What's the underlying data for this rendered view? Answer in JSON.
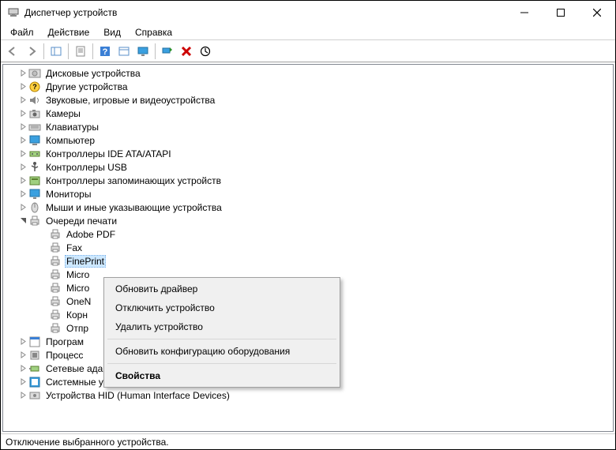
{
  "titlebar": {
    "title": "Диспетчер устройств"
  },
  "menubar": {
    "items": [
      "Файл",
      "Действие",
      "Вид",
      "Справка"
    ]
  },
  "toolbar": {
    "icons": [
      "back",
      "forward",
      "show-hide",
      "properties",
      "help",
      "options",
      "monitor",
      "scan",
      "delete",
      "update"
    ]
  },
  "tree": {
    "categories": [
      {
        "label": "Дисковые устройства",
        "icon": "disk"
      },
      {
        "label": "Другие устройства",
        "icon": "other"
      },
      {
        "label": "Звуковые, игровые и видеоустройства",
        "icon": "sound"
      },
      {
        "label": "Камеры",
        "icon": "camera"
      },
      {
        "label": "Клавиатуры",
        "icon": "keyboard"
      },
      {
        "label": "Компьютер",
        "icon": "computer"
      },
      {
        "label": "Контроллеры IDE ATA/ATAPI",
        "icon": "ide"
      },
      {
        "label": "Контроллеры USB",
        "icon": "usb"
      },
      {
        "label": "Контроллеры запоминающих устройств",
        "icon": "storage"
      },
      {
        "label": "Мониторы",
        "icon": "monitor"
      },
      {
        "label": "Мыши и иные указывающие устройства",
        "icon": "mouse"
      },
      {
        "label": "Очереди печати",
        "icon": "printer",
        "expanded": true,
        "children": [
          {
            "label": "Adobe PDF"
          },
          {
            "label": "Fax"
          },
          {
            "label": "FinePrint",
            "selected": true
          },
          {
            "label": "Micro"
          },
          {
            "label": "Micro"
          },
          {
            "label": "OneN"
          },
          {
            "label": "Корн"
          },
          {
            "label": "Отпр"
          }
        ]
      },
      {
        "label": "Програм",
        "icon": "program"
      },
      {
        "label": "Процесс",
        "icon": "cpu"
      },
      {
        "label": "Сетевые адаптеры",
        "icon": "network"
      },
      {
        "label": "Системные устройства",
        "icon": "system"
      },
      {
        "label": "Устройства HID (Human Interface Devices)",
        "icon": "hid"
      }
    ]
  },
  "context_menu": {
    "items": [
      {
        "label": "Обновить драйвер"
      },
      {
        "label": "Отключить устройство"
      },
      {
        "label": "Удалить устройство"
      },
      {
        "sep": true
      },
      {
        "label": "Обновить конфигурацию оборудования"
      },
      {
        "sep": true
      },
      {
        "label": "Свойства",
        "bold": true
      }
    ]
  },
  "statusbar": {
    "text": "Отключение выбранного устройства."
  }
}
